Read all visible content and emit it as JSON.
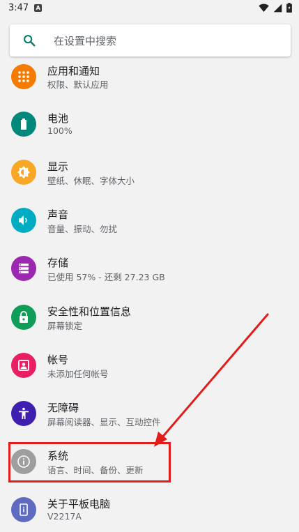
{
  "status_bar": {
    "time": "3:47",
    "badge": "A"
  },
  "search": {
    "placeholder": "在设置中搜索"
  },
  "items": [
    {
      "key": "apps",
      "title": "应用和通知",
      "subtitle": "权限、默认应用",
      "color": "#f57c00",
      "icon": "apps-grid-icon"
    },
    {
      "key": "battery",
      "title": "电池",
      "subtitle": "100%",
      "color": "#00897b",
      "icon": "battery-icon"
    },
    {
      "key": "display",
      "title": "显示",
      "subtitle": "壁纸、休眠、字体大小",
      "color": "#f9a825",
      "icon": "brightness-icon"
    },
    {
      "key": "sound",
      "title": "声音",
      "subtitle": "音量、振动、勿扰",
      "color": "#00acc1",
      "icon": "volume-icon"
    },
    {
      "key": "storage",
      "title": "存储",
      "subtitle": "已使用 57% - 还剩 27.23 GB",
      "color": "#9c27b0",
      "icon": "storage-icon"
    },
    {
      "key": "security",
      "title": "安全性和位置信息",
      "subtitle": "屏幕锁定",
      "color": "#0f9d58",
      "icon": "lock-icon"
    },
    {
      "key": "accounts",
      "title": "帐号",
      "subtitle": "未添加任何帐号",
      "color": "#e91e63",
      "icon": "account-icon"
    },
    {
      "key": "accessibility",
      "title": "无障碍",
      "subtitle": "屏幕阅读器、显示、互动控件",
      "color": "#3f1fb0",
      "icon": "accessibility-icon"
    },
    {
      "key": "system",
      "title": "系统",
      "subtitle": "语言、时间、备份、更新",
      "color": "#9e9e9e",
      "icon": "info-icon"
    },
    {
      "key": "about",
      "title": "关于平板电脑",
      "subtitle": "V2217A",
      "color": "#5e6bc0",
      "icon": "tablet-icon"
    }
  ],
  "annotation": {
    "color": "#e21b1b"
  }
}
